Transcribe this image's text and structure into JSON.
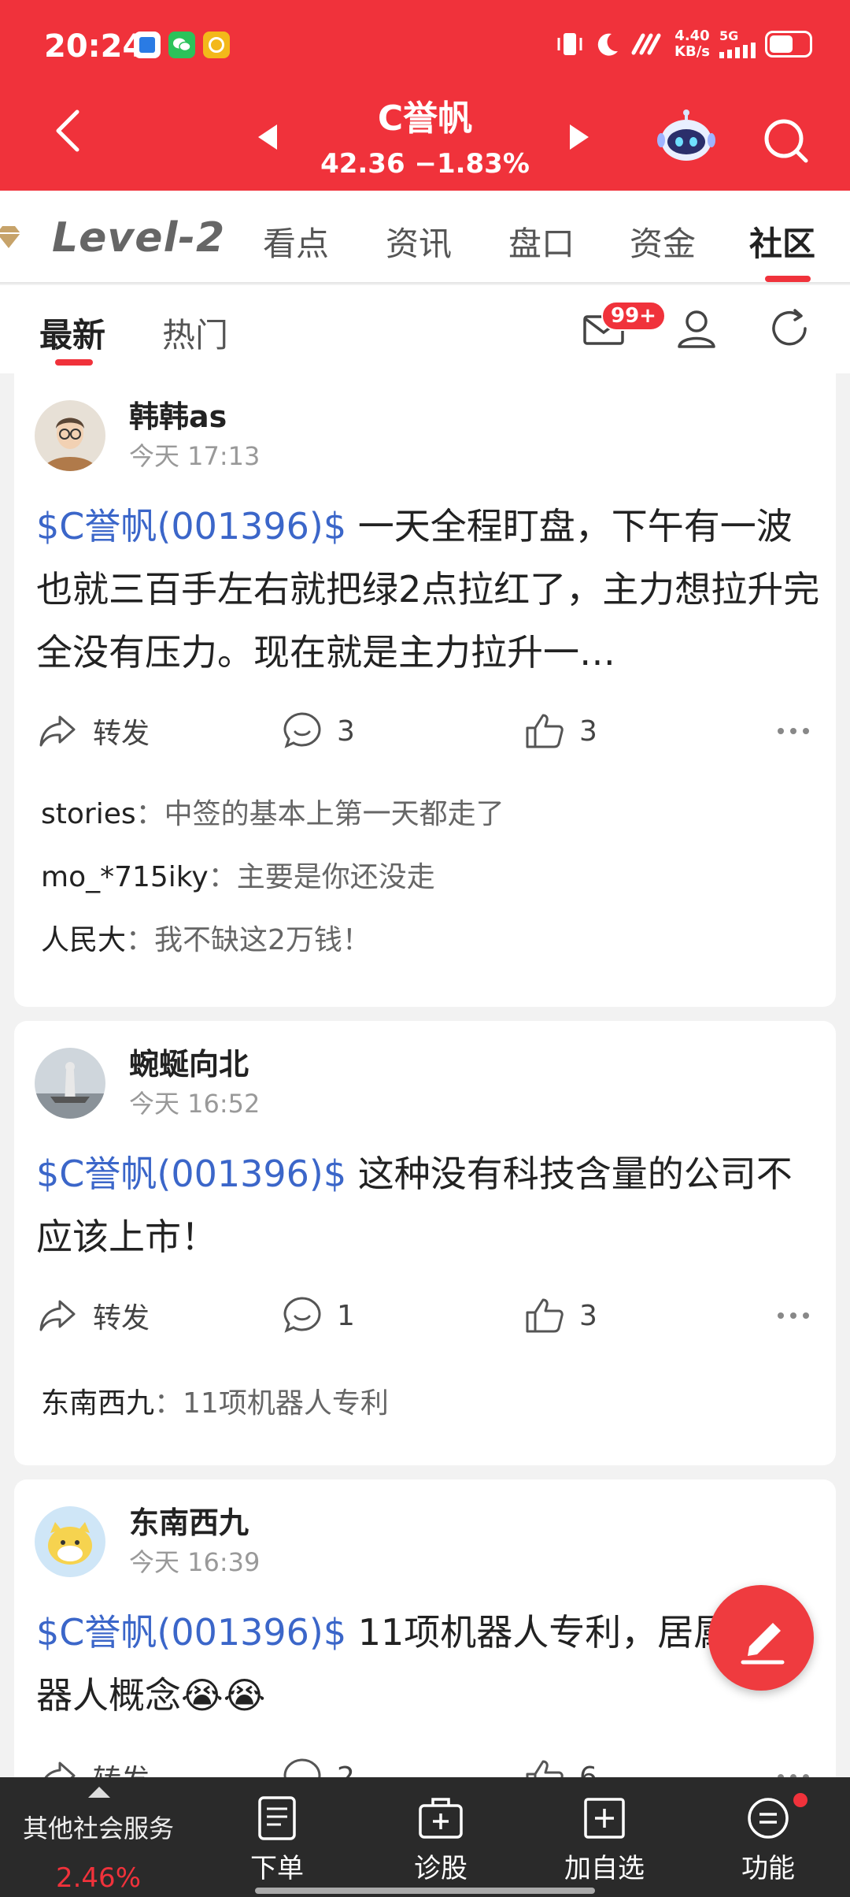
{
  "status_bar": {
    "time": "20:24",
    "net_speed": "4.40",
    "net_unit": "KB/s",
    "network": "5G",
    "battery_level": 0.6
  },
  "header": {
    "stock_name": "C誉帆",
    "price_line": "42.36 −1.83%"
  },
  "primary_tabs": {
    "level2": "Level-2",
    "items": [
      "看点",
      "资讯",
      "盘口",
      "资金",
      "社区"
    ],
    "active": "社区"
  },
  "secondary_tabs": {
    "items": [
      "最新",
      "热门"
    ],
    "active": "最新",
    "message_badge": "99+"
  },
  "posts": [
    {
      "user": "韩韩as",
      "time": "今天 17:13",
      "stock_tag": "$C誉帆(001396)$",
      "text": " 一天全程盯盘，下午有一波也就三百手左右就把绿2点拉红了，主力想拉升完全没有压力。现在就是主力拉升一…",
      "share_label": "转发",
      "comments": "3",
      "likes": "3",
      "replies": [
        {
          "user": "stories",
          "text": "中签的基本上第一天都走了"
        },
        {
          "user": "mo_*715iky",
          "text": "主要是你还没走"
        },
        {
          "user": "人民大",
          "text": "我不缺这2万钱！"
        }
      ]
    },
    {
      "user": "蜿蜒向北",
      "time": "今天 16:52",
      "stock_tag": "$C誉帆(001396)$",
      "text": " 这种没有科技含量的公司不应该上市！",
      "share_label": "转发",
      "comments": "1",
      "likes": "3",
      "replies": [
        {
          "user": "东南西九",
          "text": "11项机器人专利"
        }
      ]
    },
    {
      "user": "东南西九",
      "time": "今天 16:39",
      "stock_tag": "$C誉帆(001396)$",
      "text": " 11项机器人专利，居属于机器人概念😭😭",
      "share_label": "转发",
      "comments": "2",
      "likes": "6"
    }
  ],
  "bottom_bar": {
    "left_label": "其他社会服务",
    "left_pct": "2.46%",
    "items": [
      "下单",
      "诊股",
      "加自选",
      "功能"
    ]
  },
  "colors": {
    "brand_red": "#f0323b",
    "stock_link_blue": "#3b66c9"
  }
}
